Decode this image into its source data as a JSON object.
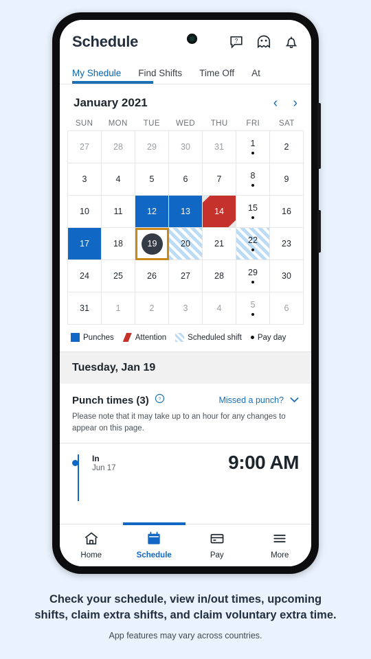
{
  "app": {
    "title": "Schedule",
    "header_icons": [
      "help-bubble-icon",
      "chatbot-face-icon",
      "bell-icon"
    ],
    "tabs": [
      {
        "label": "My Shedule",
        "active": true
      },
      {
        "label": "Find Shifts",
        "active": false
      },
      {
        "label": "Time Off",
        "active": false
      },
      {
        "label": "At",
        "active": false
      }
    ]
  },
  "calendar": {
    "month_label": "January 2021",
    "prev_label": "‹",
    "next_label": "›",
    "day_names": [
      "SUN",
      "MON",
      "TUE",
      "WED",
      "THU",
      "FRI",
      "SAT"
    ],
    "weeks": [
      [
        {
          "n": "27",
          "muted": true
        },
        {
          "n": "28",
          "muted": true
        },
        {
          "n": "29",
          "muted": true
        },
        {
          "n": "30",
          "muted": true
        },
        {
          "n": "31",
          "muted": true
        },
        {
          "n": "1",
          "payday": true
        },
        {
          "n": "2"
        }
      ],
      [
        {
          "n": "3"
        },
        {
          "n": "4"
        },
        {
          "n": "5"
        },
        {
          "n": "6"
        },
        {
          "n": "7"
        },
        {
          "n": "8",
          "payday": true
        },
        {
          "n": "9"
        }
      ],
      [
        {
          "n": "10"
        },
        {
          "n": "11"
        },
        {
          "n": "12",
          "state": "punch"
        },
        {
          "n": "13",
          "state": "punch"
        },
        {
          "n": "14",
          "state": "attention"
        },
        {
          "n": "15",
          "payday": true
        },
        {
          "n": "16"
        }
      ],
      [
        {
          "n": "17",
          "state": "punch"
        },
        {
          "n": "18"
        },
        {
          "n": "19",
          "selected": true
        },
        {
          "n": "20",
          "state": "shift"
        },
        {
          "n": "21"
        },
        {
          "n": "22",
          "state": "shift",
          "payday": true
        },
        {
          "n": "23"
        }
      ],
      [
        {
          "n": "24"
        },
        {
          "n": "25"
        },
        {
          "n": "26"
        },
        {
          "n": "27"
        },
        {
          "n": "28"
        },
        {
          "n": "29",
          "payday": true
        },
        {
          "n": "30"
        }
      ],
      [
        {
          "n": "31"
        },
        {
          "n": "1",
          "muted": true
        },
        {
          "n": "2",
          "muted": true
        },
        {
          "n": "3",
          "muted": true
        },
        {
          "n": "4",
          "muted": true
        },
        {
          "n": "5",
          "muted": true,
          "payday": true
        },
        {
          "n": "6",
          "muted": true
        }
      ]
    ],
    "legend": [
      {
        "label": "Punches",
        "swatch": "blue"
      },
      {
        "label": "Attention",
        "swatch": "red"
      },
      {
        "label": "Scheduled shift",
        "swatch": "striped"
      },
      {
        "label": "Pay day",
        "swatch": "dot"
      }
    ]
  },
  "day_detail": {
    "date_heading": "Tuesday, Jan 19",
    "punch_title": "Punch times (3)",
    "help_icon": "question-circle-icon",
    "missed_punch_link": "Missed a punch?",
    "chevron": "chevron-down-icon",
    "note": "Please note that it may take up to an hour for any changes to appear on this page.",
    "entries": [
      {
        "type": "In",
        "date": "Jun 17",
        "time": "9:00 AM"
      }
    ]
  },
  "bottom_nav": [
    {
      "label": "Home",
      "icon": "home-icon",
      "active": false
    },
    {
      "label": "Schedule",
      "icon": "calendar-icon",
      "active": true
    },
    {
      "label": "Pay",
      "icon": "card-icon",
      "active": false
    },
    {
      "label": "More",
      "icon": "hamburger-icon",
      "active": false
    }
  ],
  "caption": {
    "line1": "Check your schedule, view in/out times, upcoming",
    "line2": "shifts, claim extra shifts, and claim voluntary extra time.",
    "sub": "App features may vary across countries."
  },
  "colors": {
    "page_background": "#e9f2fd",
    "accent_blue": "#1168c4",
    "link_blue": "#1a6fb5",
    "attention_red": "#c5322c",
    "selected_gold": "#c8891a",
    "shift_blue": "#bcdcf5",
    "text_dark": "#1d252d"
  }
}
